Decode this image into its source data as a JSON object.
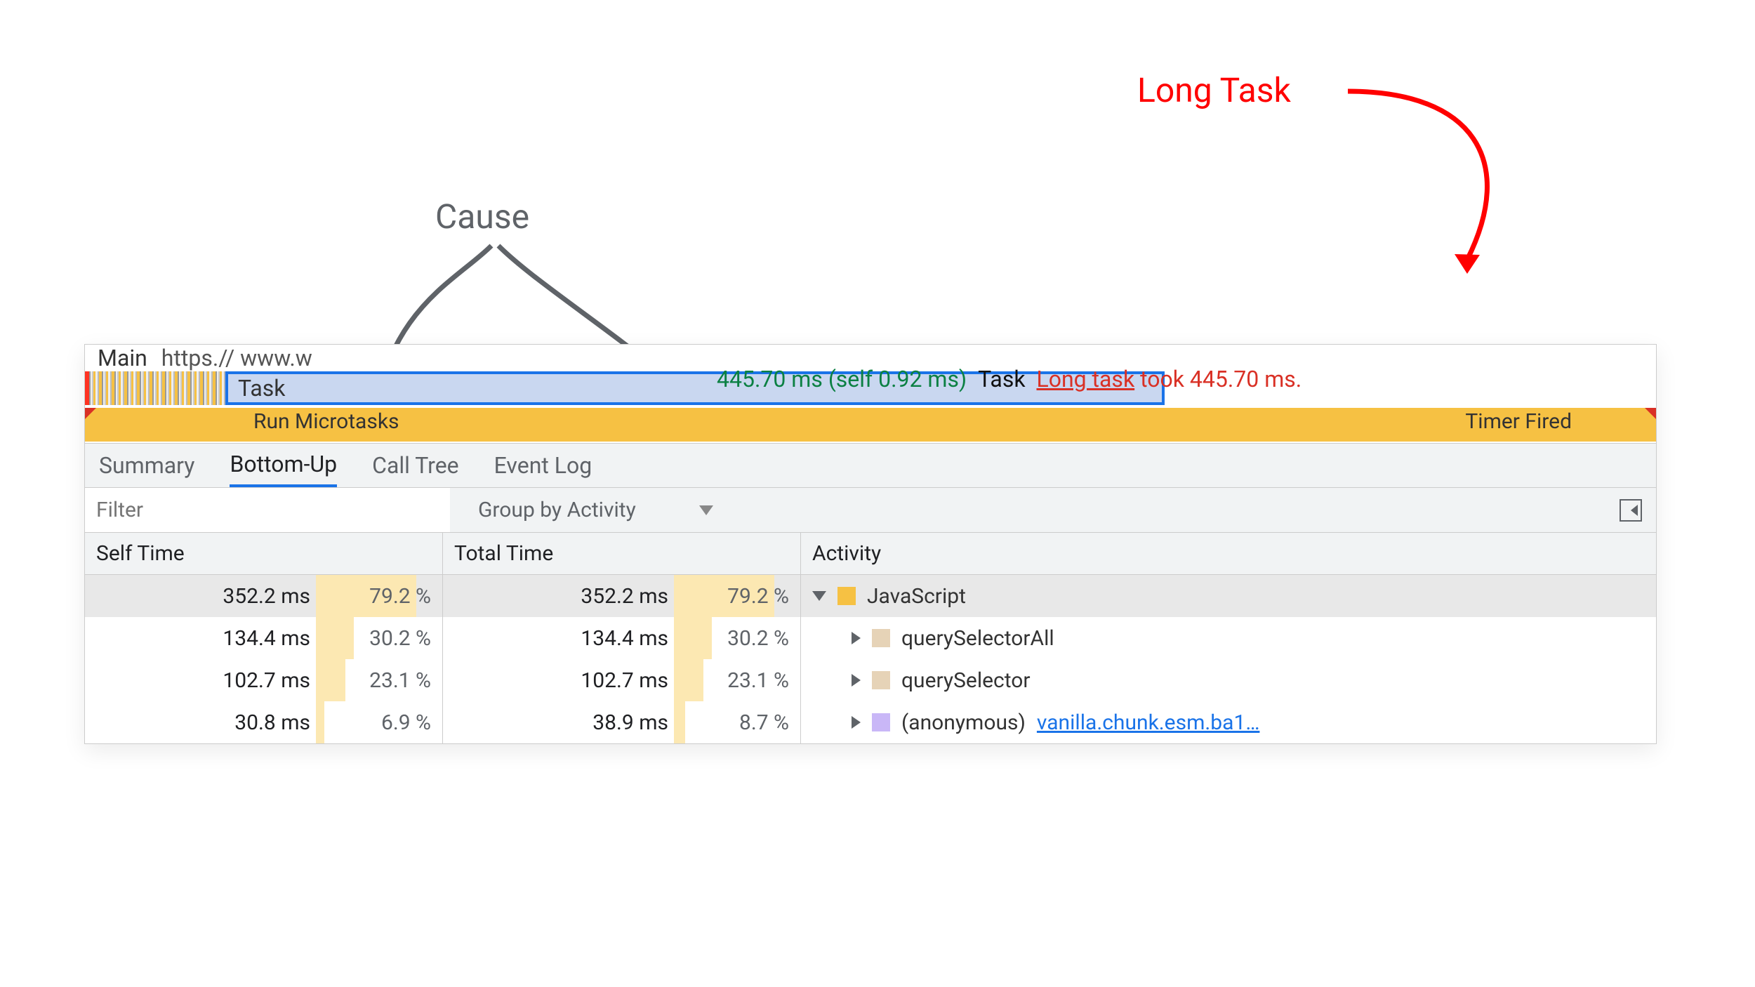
{
  "annotations": {
    "long_task": "Long Task",
    "cause": "Cause"
  },
  "flame": {
    "main_label": "Main",
    "url_fragment": "https.// www.w",
    "task_label": "Task",
    "duration_text": "445.70 ms (self 0.92 ms)",
    "task_word": "Task",
    "long_task_word": "Long task",
    "took_text": "took 445.70 ms.",
    "microtasks_label": "Run Microtasks",
    "timer_fired_label": "Timer Fired"
  },
  "tabs": {
    "summary": "Summary",
    "bottom_up": "Bottom-Up",
    "call_tree": "Call Tree",
    "event_log": "Event Log"
  },
  "toolbar": {
    "filter_placeholder": "Filter",
    "group_by": "Group by Activity"
  },
  "columns": {
    "self": "Self Time",
    "total": "Total Time",
    "activity": "Activity"
  },
  "rows": [
    {
      "self_ms": "352.2 ms",
      "self_pct": "79.2 %",
      "self_pct_w": 79.2,
      "total_ms": "352.2 ms",
      "total_pct": "79.2 %",
      "total_pct_w": 79.2,
      "activity": "JavaScript",
      "color": "yellow",
      "expanded": true,
      "selected": true,
      "indent": 0
    },
    {
      "self_ms": "134.4 ms",
      "self_pct": "30.2 %",
      "self_pct_w": 30.2,
      "total_ms": "134.4 ms",
      "total_pct": "30.2 %",
      "total_pct_w": 30.2,
      "activity": "querySelectorAll",
      "color": "tan",
      "expanded": false,
      "indent": 1
    },
    {
      "self_ms": "102.7 ms",
      "self_pct": "23.1 %",
      "self_pct_w": 23.1,
      "total_ms": "102.7 ms",
      "total_pct": "23.1 %",
      "total_pct_w": 23.1,
      "activity": "querySelector",
      "color": "tan",
      "expanded": false,
      "indent": 1
    },
    {
      "self_ms": "30.8 ms",
      "self_pct": "6.9 %",
      "self_pct_w": 6.9,
      "total_ms": "38.9 ms",
      "total_pct": "8.7 %",
      "total_pct_w": 8.7,
      "activity": "(anonymous)",
      "color": "purple",
      "expanded": false,
      "indent": 1,
      "link": "vanilla.chunk.esm.ba1…"
    }
  ]
}
